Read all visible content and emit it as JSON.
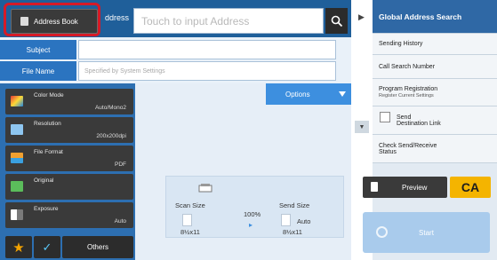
{
  "header": {
    "address_book_label": "Address Book",
    "address_label": "ddress",
    "address_placeholder": "Touch to input Address"
  },
  "form": {
    "subject_label": "Subject",
    "subject_value": "",
    "filename_label": "File Name",
    "filename_placeholder": "Specified by System Settings"
  },
  "left_panel": {
    "items": [
      {
        "title": "Color Mode",
        "value": "Auto/Mono2",
        "icon": "color-mode-icon"
      },
      {
        "title": "Resolution",
        "value": "200x200dpi",
        "icon": "resolution-icon"
      },
      {
        "title": "File Format",
        "value": "PDF",
        "icon": "file-format-icon"
      },
      {
        "title": "Original",
        "value": "",
        "icon": "original-icon"
      },
      {
        "title": "Exposure",
        "value": "Auto",
        "icon": "exposure-icon"
      }
    ],
    "others_label": "Others"
  },
  "options": {
    "label": "Options"
  },
  "size_panel": {
    "scan_label": "Scan Size",
    "scan_value": "8½x11",
    "ratio": "100%",
    "send_label": "Send Size",
    "send_mode": "Auto",
    "send_value": "8½x11"
  },
  "right_panel": {
    "items": [
      {
        "label": "Global Address Search",
        "sub": ""
      },
      {
        "label": "Sending History",
        "sub": ""
      },
      {
        "label": "Call Search Number",
        "sub": ""
      },
      {
        "label": "Program Registration",
        "sub": "Register Current Settings"
      },
      {
        "label": "Send",
        "sub": "Destination Link"
      },
      {
        "label": "Check Send/Receive",
        "sub": "Status"
      }
    ]
  },
  "actions": {
    "preview_label": "Preview",
    "ca_label": "CA",
    "start_label": "Start"
  },
  "colors": {
    "header_blue": "#1f5f9a",
    "highlight_red": "#d51a27",
    "ca_yellow": "#f4b400"
  }
}
